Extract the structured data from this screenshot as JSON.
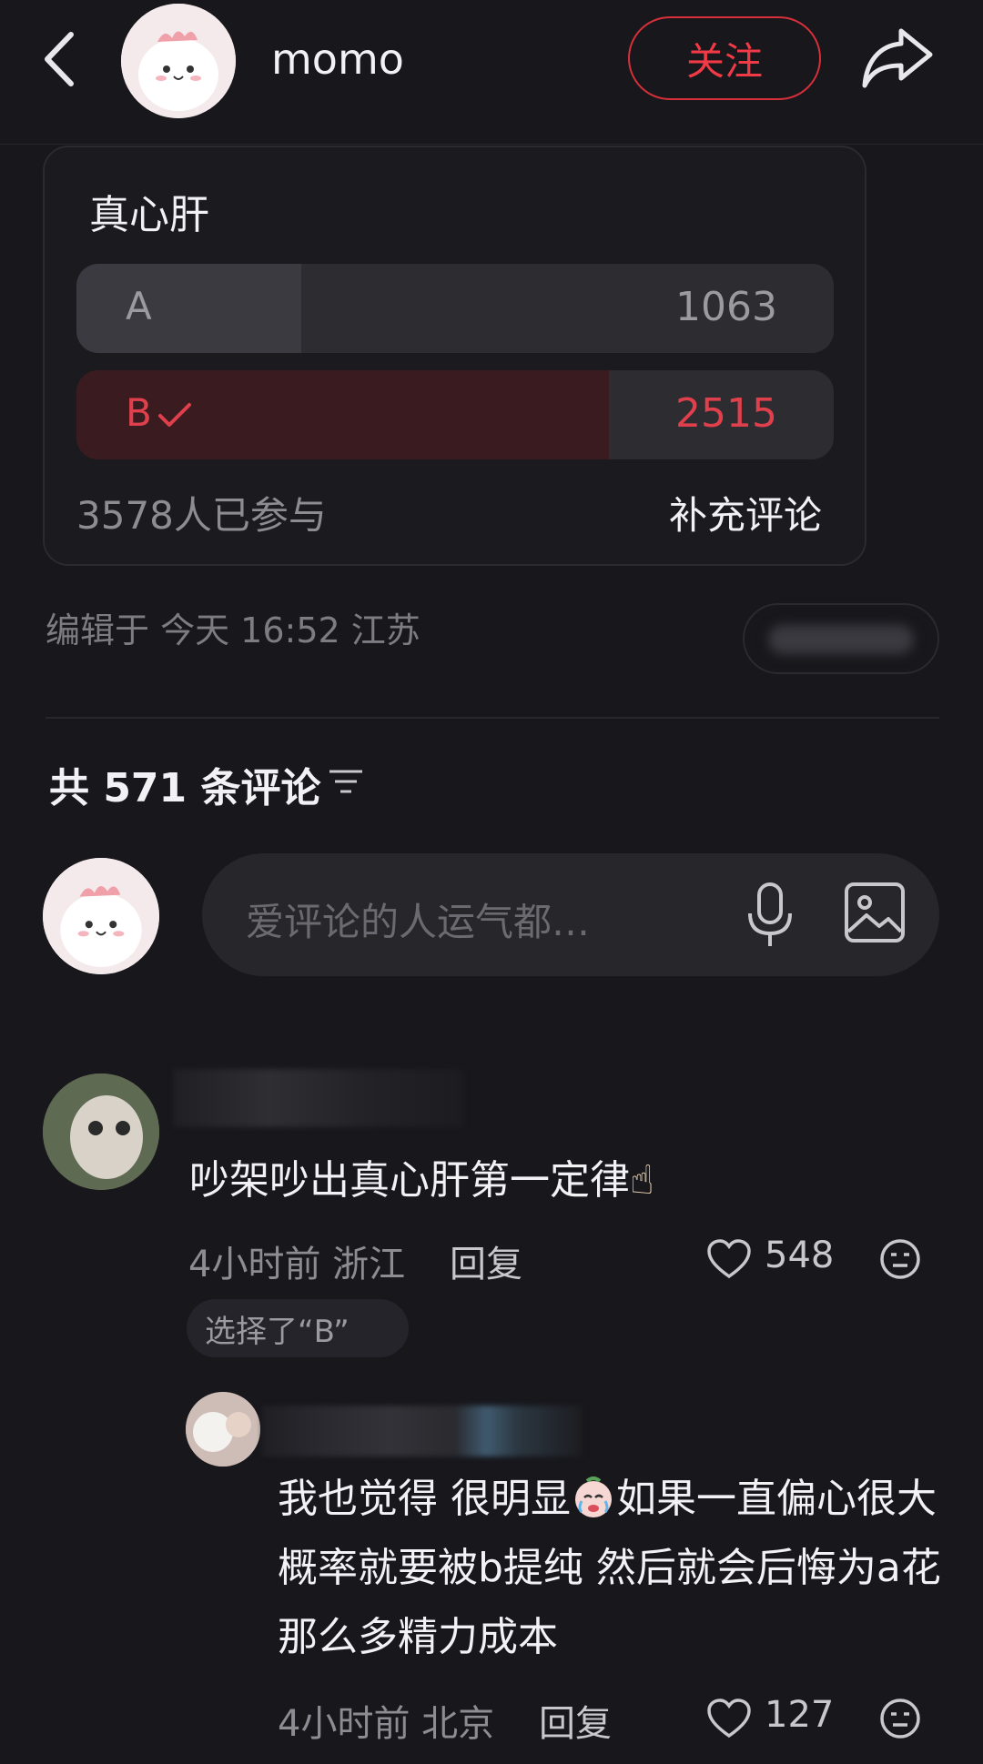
{
  "header": {
    "author_name": "momo",
    "follow_label": "关注"
  },
  "poll": {
    "title": "真心肝",
    "options": [
      {
        "label": "A",
        "count": "1063",
        "share": 0.297,
        "selected": false
      },
      {
        "label": "B",
        "count": "2515",
        "share": 0.703,
        "selected": true
      }
    ],
    "participants": "3578人已参与",
    "add_comment_label": "补充评论"
  },
  "post_meta": {
    "edited": "编辑于 今天 16:52 江苏"
  },
  "comments_section": {
    "count_label": "共 571 条评论",
    "input_placeholder": "爱评论的人运气都…"
  },
  "comments": [
    {
      "text": "吵架吵出真心肝第一定律",
      "emoji": "☝",
      "meta": "4小时前 浙江",
      "reply_label": "回复",
      "likes": "548",
      "choice_tag": "选择了“B”"
    },
    {
      "text_part1": "我也觉得 很明显",
      "text_part2": "如果一直偏心很大概率就要被b提纯 然后就会后悔为a花那么多精力成本",
      "meta": "4小时前 北京",
      "reply_label": "回复",
      "likes": "127"
    }
  ],
  "colors": {
    "background": "#17171c",
    "accent_red": "#f03a46",
    "poll_b_fill": "#3a1c20"
  }
}
